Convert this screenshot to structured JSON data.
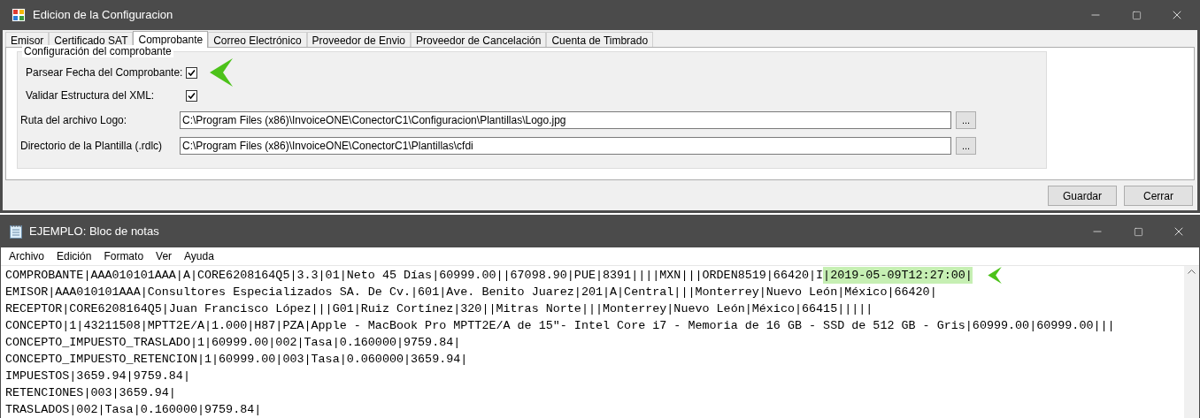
{
  "config_window": {
    "title": "Edicion de la Configuracion",
    "tabs": [
      {
        "label": "Emisor",
        "selected": false
      },
      {
        "label": "Certificado SAT",
        "selected": false
      },
      {
        "label": "Comprobante",
        "selected": true
      },
      {
        "label": "Correo Electrónico",
        "selected": false
      },
      {
        "label": "Proveedor de Envio",
        "selected": false
      },
      {
        "label": "Proveedor de Cancelación",
        "selected": false
      },
      {
        "label": "Cuenta de Timbrado",
        "selected": false
      }
    ],
    "group_title": "Configuración del comprobante",
    "checks": [
      {
        "label": "Parsear Fecha del Comprobante:",
        "checked": true,
        "pointed": true
      },
      {
        "label": "Validar Estructura del XML:",
        "checked": true,
        "pointed": false
      }
    ],
    "paths": [
      {
        "label": "Ruta del archivo Logo:",
        "value": "C:\\Program Files (x86)\\InvoiceONE\\ConectorC1\\Configuracion\\Plantillas\\Logo.jpg",
        "browse": "..."
      },
      {
        "label": "Directorio de la Plantilla (.rdlc)",
        "value": "C:\\Program Files (x86)\\InvoiceONE\\ConectorC1\\Plantillas\\cfdi",
        "browse": "..."
      }
    ],
    "buttons": [
      "Guardar",
      "Cerrar"
    ]
  },
  "notepad": {
    "title": "EJEMPLO: Bloc de notas",
    "menu": [
      "Archivo",
      "Edición",
      "Formato",
      "Ver",
      "Ayuda"
    ],
    "lines": [
      {
        "text": "COMPROBANTE|AAA010101AAA|A|CORE6208164Q5|3.3|01|Neto 45 Días|60999.00||67098.90|PUE|8391||||MXN|||ORDEN8519|66420|I",
        "highlight": "|2019-05-09T12:27:00|"
      },
      {
        "text": "EMISOR|AAA010101AAA|Consultores Especializados SA. De Cv.|601|Ave. Benito Juarez|201|A|Central|||Monterrey|Nuevo León|México|66420|"
      },
      {
        "text": "RECEPTOR|CORE6208164Q5|Juan Francisco López|||G01|Ruiz Cortínez|320||Mitras Norte|||Monterrey|Nuevo León|México|66415|||||"
      },
      {
        "text": "CONCEPTO|1|43211508|MPTT2E/A|1.000|H87|PZA|Apple - MacBook Pro MPTT2E/A de 15\"- Intel Core i7 - Memoria de 16 GB - SSD de 512 GB - Gris|60999.00|60999.00|||"
      },
      {
        "text": "CONCEPTO_IMPUESTO_TRASLADO|1|60999.00|002|Tasa|0.160000|9759.84|"
      },
      {
        "text": "CONCEPTO_IMPUESTO_RETENCION|1|60999.00|003|Tasa|0.060000|3659.94|"
      },
      {
        "text": "IMPUESTOS|3659.94|9759.84|"
      },
      {
        "text": "RETENCIONES|003|3659.94|"
      },
      {
        "text": "TRASLADOS|002|Tasa|0.160000|9759.84|"
      }
    ]
  }
}
